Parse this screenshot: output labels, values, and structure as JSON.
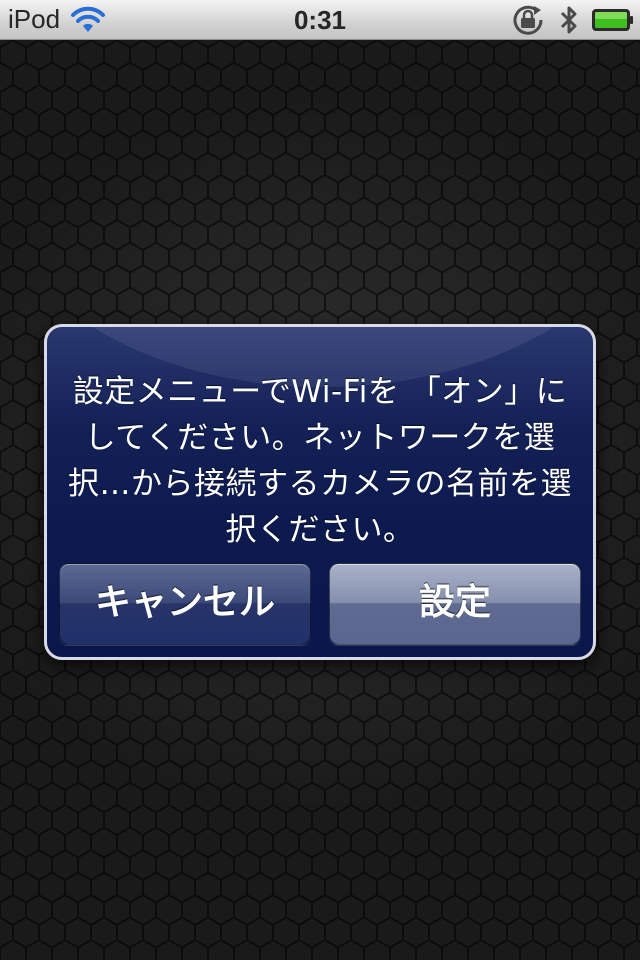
{
  "status_bar": {
    "carrier": "iPod",
    "time": "0:31",
    "icons": [
      "wifi-icon",
      "rotation-lock-icon",
      "bluetooth-icon",
      "battery-icon"
    ]
  },
  "alert": {
    "message_lines": [
      "設定メニューでWi-Fiを 「オン」に",
      "してください。ネットワークを選",
      "択…から接続するカメラの名前を選",
      "択ください。"
    ],
    "buttons": {
      "cancel": "キャンセル",
      "settings": "設定"
    }
  },
  "colors": {
    "alert_background": "#0c1a4f",
    "alert_border": "#d8dbe4",
    "status_bar": "#d2d2d2",
    "battery_fill": "#3fbf1f",
    "wifi": "#2a6fd6"
  }
}
